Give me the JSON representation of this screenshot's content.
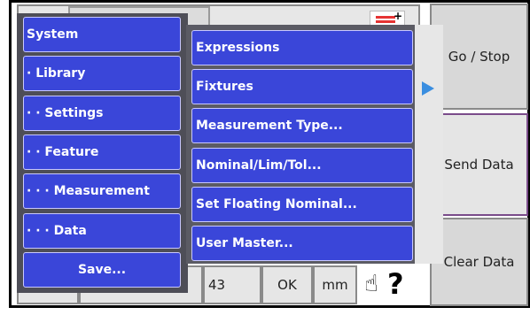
{
  "main_menu": {
    "items": [
      {
        "label": "System"
      },
      {
        "label": "· Library"
      },
      {
        "label": "· · Settings"
      },
      {
        "label": "· · Feature"
      },
      {
        "label": "· · · Measurement"
      },
      {
        "label": "· · · Data"
      },
      {
        "label": "Save..."
      }
    ]
  },
  "submenu": {
    "items": [
      {
        "label": "Expressions"
      },
      {
        "label": "Fixtures"
      },
      {
        "label": "Measurement Type..."
      },
      {
        "label": "Nominal/Lim/Tol..."
      },
      {
        "label": "Set Floating Nominal..."
      },
      {
        "label": "User Master..."
      }
    ]
  },
  "right_buttons": {
    "go_stop": "Go / Stop",
    "send_data": "Send Data",
    "clear_data": "Clear Data"
  },
  "bottom_bar": {
    "value": "43",
    "ok": "OK",
    "unit": "mm"
  },
  "icons": {
    "submenu_arrow": "triangle-right-icon",
    "help": "hand-help-icon",
    "flag": "flag-icon"
  },
  "colors": {
    "menu_item": "#3a46d9",
    "arrow": "#3a8ee0"
  }
}
